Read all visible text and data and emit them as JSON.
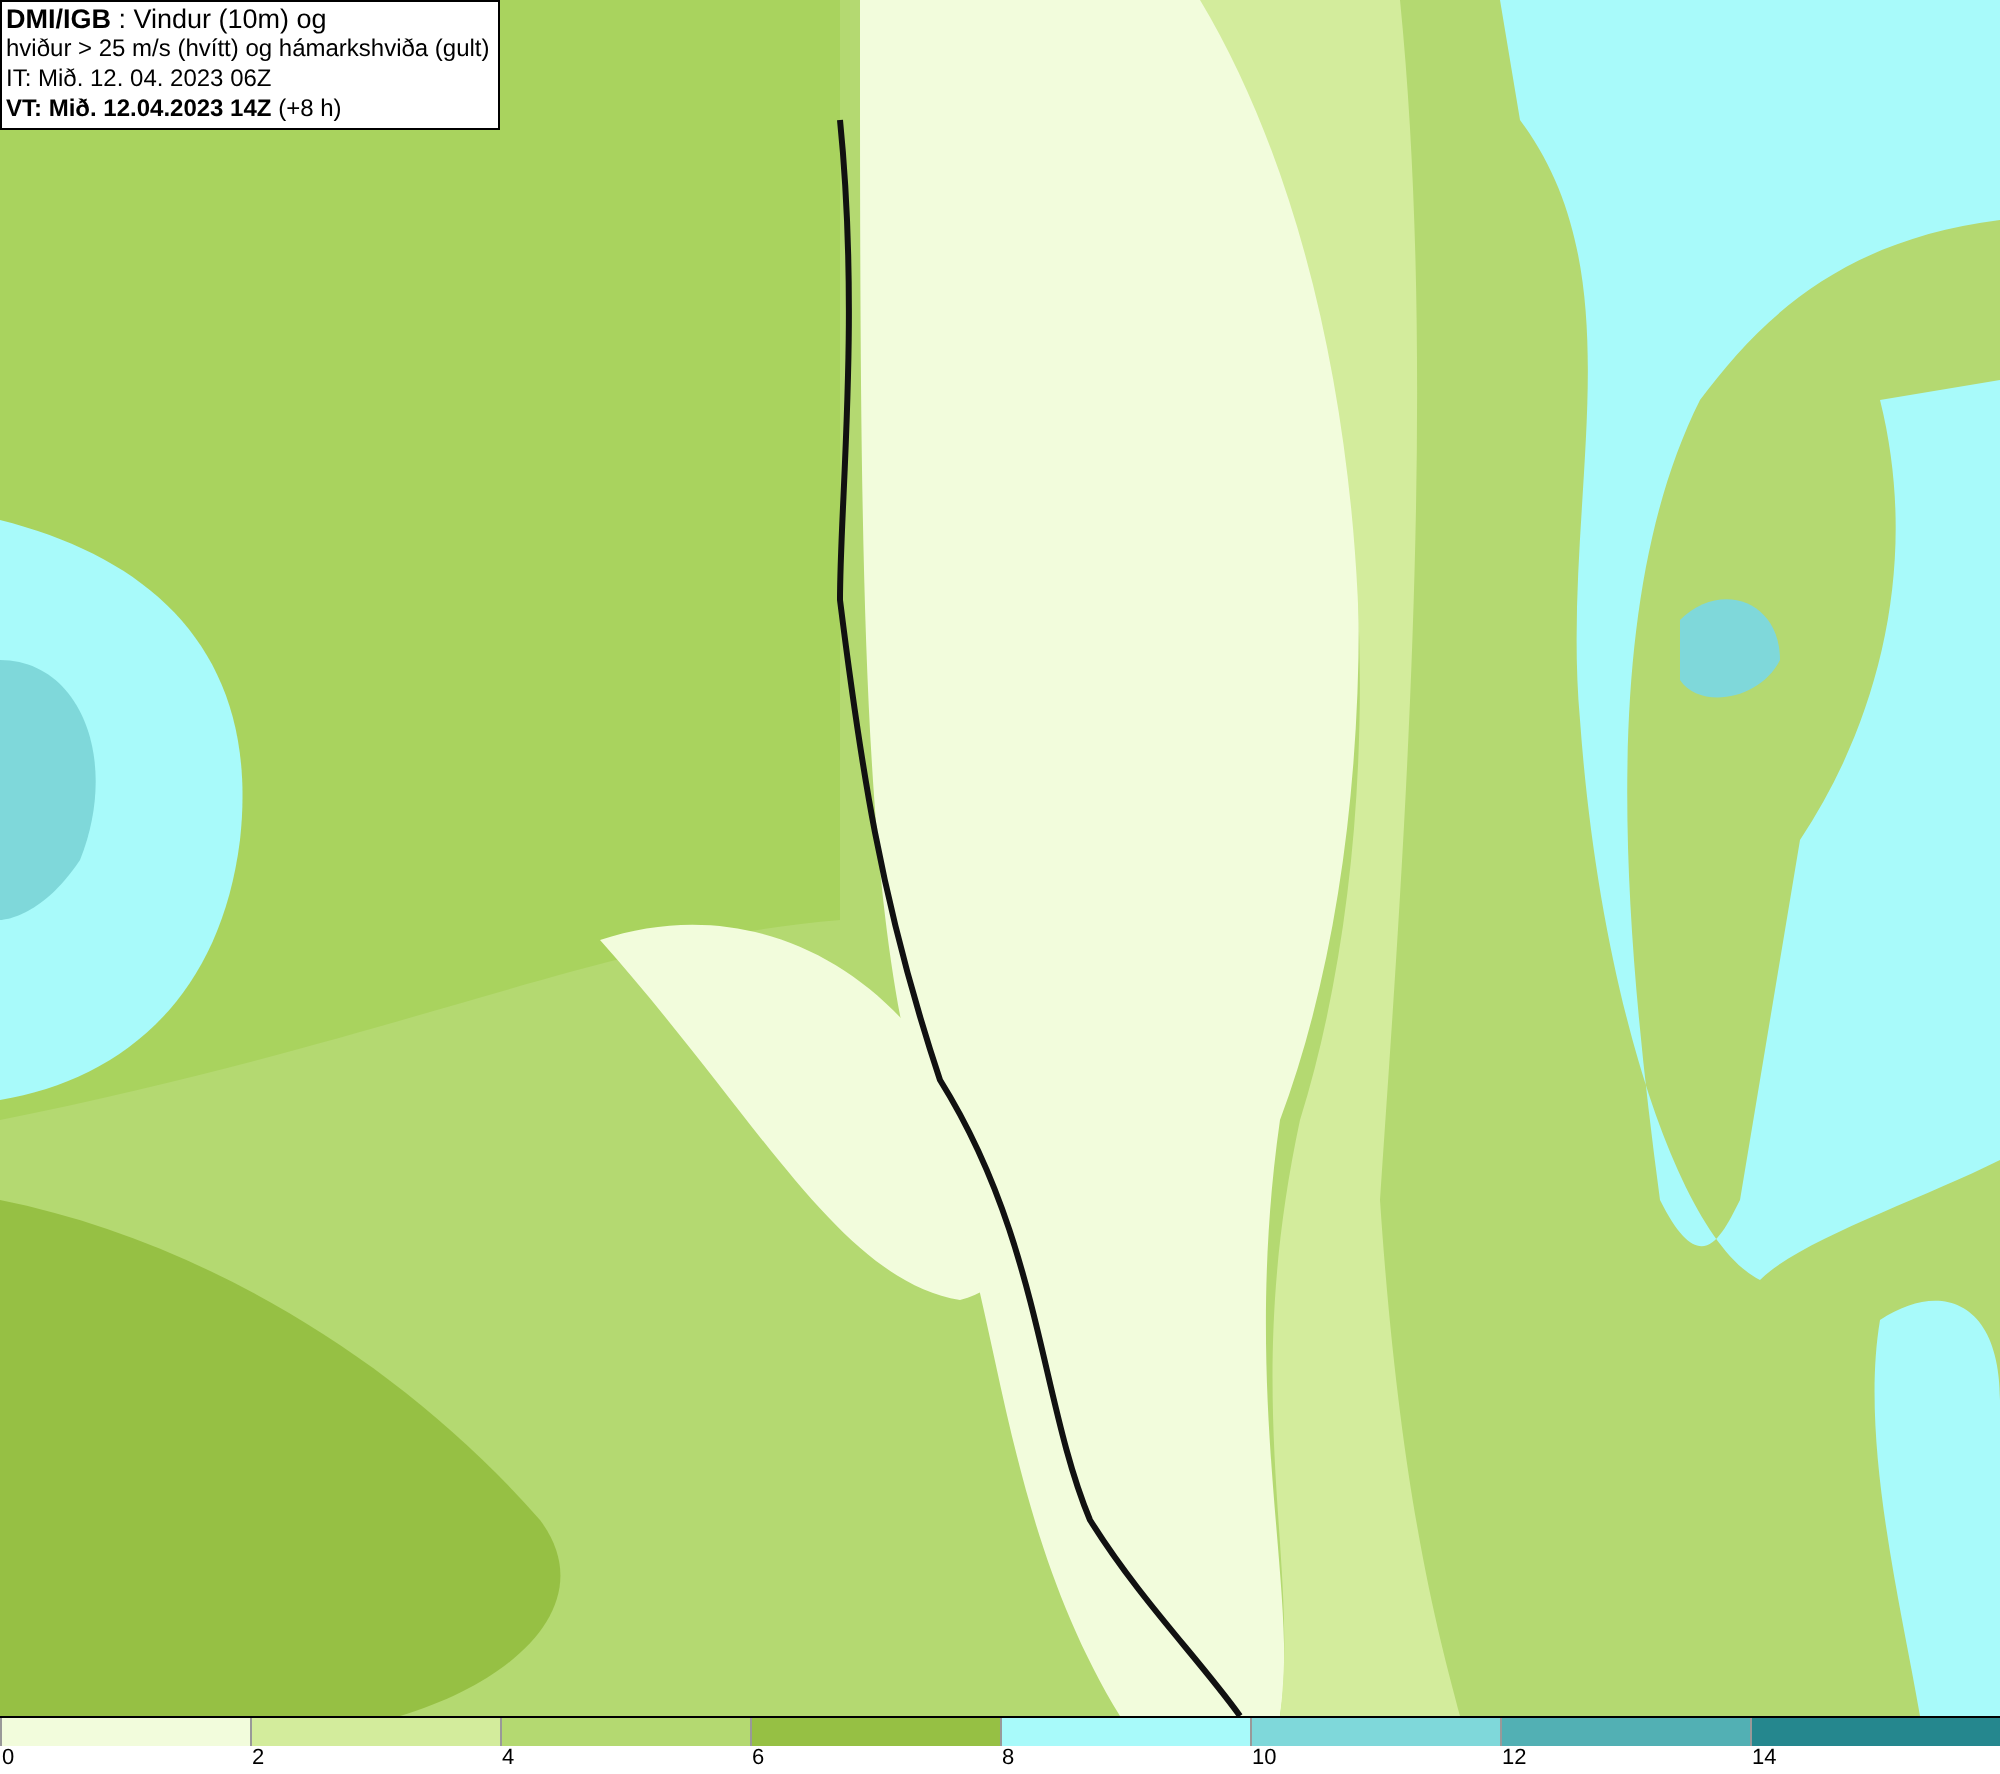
{
  "title_box": {
    "lines": [
      "**DMI/IGB** : Vindur (10m) og",
      "hviður > 25 m/s (hvítt) og hámarkshviða (gult)",
      "IT: Mið. 12. 04. 2023 06Z",
      "**VT: Mið. 12.04.2023 14Z** (+8 h)"
    ]
  },
  "legend": [
    {
      "label": "0",
      "color": "#f2fcdc"
    },
    {
      "label": "2",
      "color": "#d3ec9c"
    },
    {
      "label": "4",
      "color": "#b4d971"
    },
    {
      "label": "6",
      "color": "#96c044"
    },
    {
      "label": "8",
      "color": "#a8fafa"
    },
    {
      "label": "10",
      "color": "#7fd8da"
    },
    {
      "label": "12",
      "color": "#52b0b4"
    },
    {
      "label": "14",
      "color": "#25878e"
    }
  ]
}
